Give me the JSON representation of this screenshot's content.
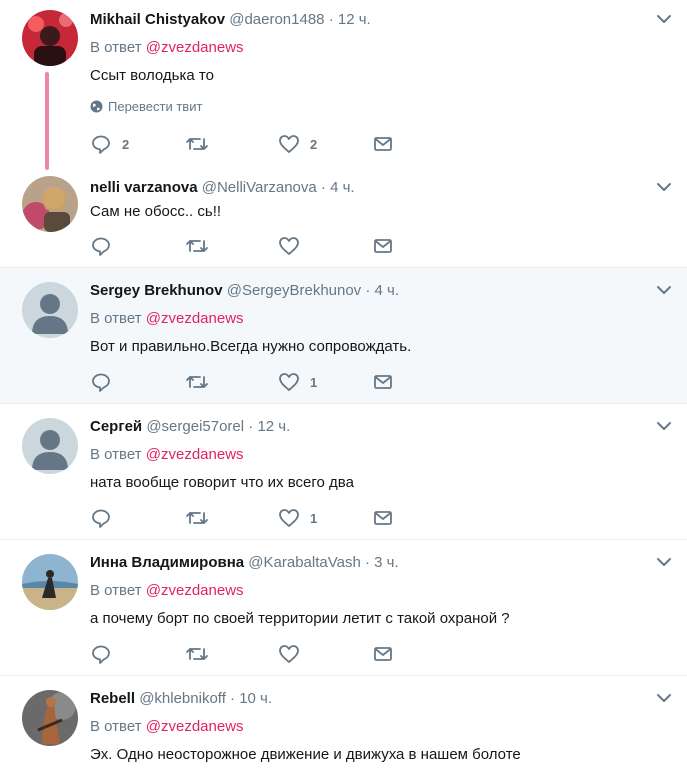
{
  "tweets": [
    {
      "name": "Mikhail Chistyakov",
      "handle": "@daeron1488",
      "time": "12 ч.",
      "reply_prefix": "В ответ",
      "reply_mention": "@zvezdanews",
      "text": "Ссыт володька то",
      "translate": "Перевести твит",
      "reply_count": "2",
      "retweet_count": "",
      "like_count": "2"
    },
    {
      "name": "nelli varzanova",
      "handle": "@NelliVarzanova",
      "time": "4 ч.",
      "text": "Сам не обосс.. сь!!",
      "reply_count": "",
      "retweet_count": "",
      "like_count": ""
    },
    {
      "name": "Sergey Brekhunov",
      "handle": "@SergeyBrekhunov",
      "time": "4 ч.",
      "reply_prefix": "В ответ",
      "reply_mention": "@zvezdanews",
      "text": "Вот и правильно.Всегда нужно сопровождать.",
      "reply_count": "",
      "retweet_count": "",
      "like_count": "1"
    },
    {
      "name": "Сергей",
      "handle": "@sergei57orel",
      "time": "12 ч.",
      "reply_prefix": "В ответ",
      "reply_mention": "@zvezdanews",
      "text": "ната вообще говорит что их всего два",
      "reply_count": "",
      "retweet_count": "",
      "like_count": "1"
    },
    {
      "name": "Инна Владимировна",
      "handle": "@KarabaltaVash",
      "time": "3 ч.",
      "reply_prefix": "В ответ",
      "reply_mention": "@zvezdanews",
      "text": "а почему борт по своей территории летит с такой охраной ?",
      "reply_count": "",
      "retweet_count": "",
      "like_count": ""
    },
    {
      "name": "Rebell",
      "handle": "@khlebnikoff",
      "time": "10 ч.",
      "reply_prefix": "В ответ",
      "reply_mention": "@zvezdanews",
      "text": "Эх. Одно неосторожное движение и движуха в нашем болоте"
    }
  ],
  "separator": "·",
  "icons": {
    "reply": "reply-icon",
    "retweet": "retweet-icon",
    "like": "heart-icon",
    "dm": "envelope-icon",
    "more": "chevron-down-icon",
    "globe": "globe-icon"
  },
  "colors": {
    "mention": "#e0245e",
    "muted": "#657786",
    "highlight_bg": "#f5f8fa",
    "thread_line": "#e0245e"
  }
}
